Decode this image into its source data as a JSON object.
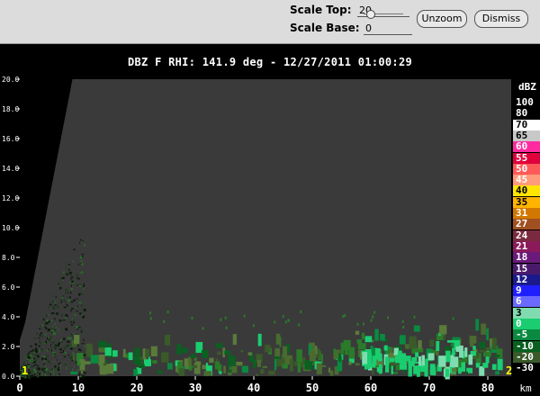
{
  "toolbar": {
    "scale_top_label": "Scale Top:",
    "scale_top_value": "20",
    "scale_base_label": "Scale Base:",
    "scale_base_value": "0",
    "unzoom_label": "Unzoom",
    "dismiss_label": "Dismiss"
  },
  "title": "DBZ F  RHI: 141.9 deg  -  12/27/2011 01:00:29",
  "colorbar": {
    "units": "dBZ",
    "entries": [
      {
        "label": "100",
        "color": "#000000",
        "text": "#ffffff"
      },
      {
        "label": "80",
        "color": "#000000",
        "text": "#ffffff"
      },
      {
        "label": "70",
        "color": "#ffffff",
        "text": "#000000"
      },
      {
        "label": "65",
        "color": "#c8c8c8",
        "text": "#000000"
      },
      {
        "label": "60",
        "color": "#ff2aa0",
        "text": "#ffffff"
      },
      {
        "label": "55",
        "color": "#e0003c",
        "text": "#ffffff"
      },
      {
        "label": "50",
        "color": "#ff5a5a",
        "text": "#ffffff"
      },
      {
        "label": "45",
        "color": "#ff9a7a",
        "text": "#ffffff"
      },
      {
        "label": "40",
        "color": "#ffe600",
        "text": "#000000"
      },
      {
        "label": "35",
        "color": "#ffb400",
        "text": "#000000"
      },
      {
        "label": "31",
        "color": "#d27800",
        "text": "#ffffff"
      },
      {
        "label": "27",
        "color": "#a05020",
        "text": "#ffffff"
      },
      {
        "label": "24",
        "color": "#7a2a40",
        "text": "#ffffff"
      },
      {
        "label": "21",
        "color": "#8a1a5a",
        "text": "#ffffff"
      },
      {
        "label": "18",
        "color": "#6a1a7a",
        "text": "#ffffff"
      },
      {
        "label": "15",
        "color": "#4a1a6a",
        "text": "#ffffff"
      },
      {
        "label": "12",
        "color": "#1a1a8a",
        "text": "#ffffff"
      },
      {
        "label": "9",
        "color": "#2020ff",
        "text": "#ffffff"
      },
      {
        "label": "6",
        "color": "#6a6aff",
        "text": "#ffffff"
      },
      {
        "label": "3",
        "color": "#80dcb0",
        "text": "#000000"
      },
      {
        "label": "0",
        "color": "#1acd70",
        "text": "#ffffff"
      },
      {
        "label": "-5",
        "color": "#0a8a40",
        "text": "#ffffff"
      },
      {
        "label": "-10",
        "color": "#0a6020",
        "text": "#ffffff"
      },
      {
        "label": "-20",
        "color": "#3a5a2a",
        "text": "#ffffff"
      },
      {
        "label": "-30",
        "color": "#000000",
        "text": "#ffffff"
      }
    ]
  },
  "axes": {
    "x_ticks": [
      "0",
      "10",
      "20",
      "30",
      "40",
      "50",
      "60",
      "70",
      "80"
    ],
    "x_unit": "km",
    "y_ticks": [
      "0.0",
      "2.0",
      "4.0",
      "6.0",
      "8.0",
      "10.0",
      "12.0",
      "14.0",
      "16.0",
      "18.0",
      "20.0"
    ],
    "corner_left": "1",
    "corner_right": "2"
  },
  "colors": {
    "background": "#000000",
    "no_data": "#3a3a3a",
    "axis_text": "#ffffff",
    "corner_marker": "#ffff00"
  }
}
